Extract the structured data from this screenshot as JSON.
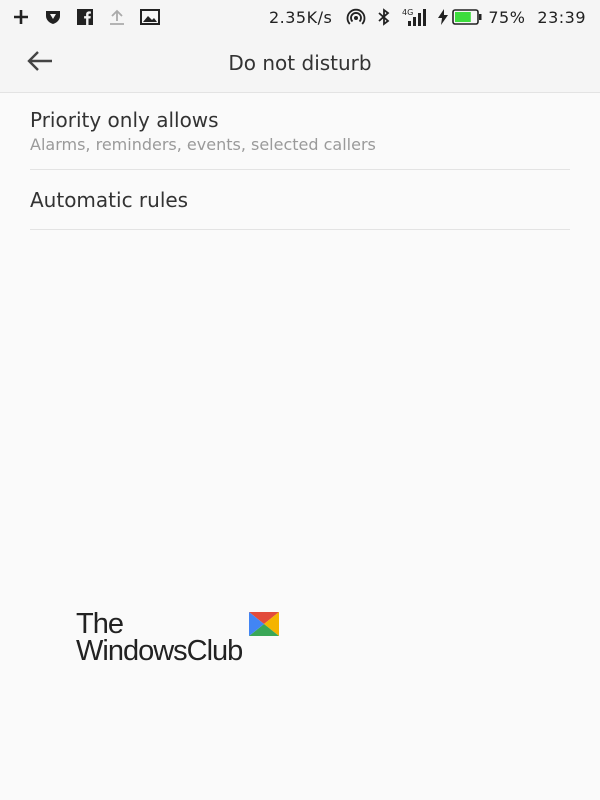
{
  "status_bar": {
    "speed": "2.35K/s",
    "network": "4G",
    "battery": "75%",
    "time": "23:39",
    "icons": [
      "plus-icon",
      "shield-icon",
      "facebook-icon",
      "upload-icon",
      "image-icon",
      "hotspot-icon",
      "bluetooth-icon",
      "signal-icon",
      "charging-icon",
      "battery-icon"
    ],
    "battery_color": "#3ddc3d"
  },
  "toolbar": {
    "title": "Do not disturb"
  },
  "settings": {
    "items": [
      {
        "title": "Priority only allows",
        "subtitle": "Alarms, reminders, events, selected callers"
      },
      {
        "title": "Automatic rules"
      }
    ]
  },
  "watermark": {
    "line1": "The",
    "line2": "WindowsClub",
    "colors": [
      "#e24b3b",
      "#f4b400",
      "#4285f4",
      "#3aa757"
    ]
  }
}
